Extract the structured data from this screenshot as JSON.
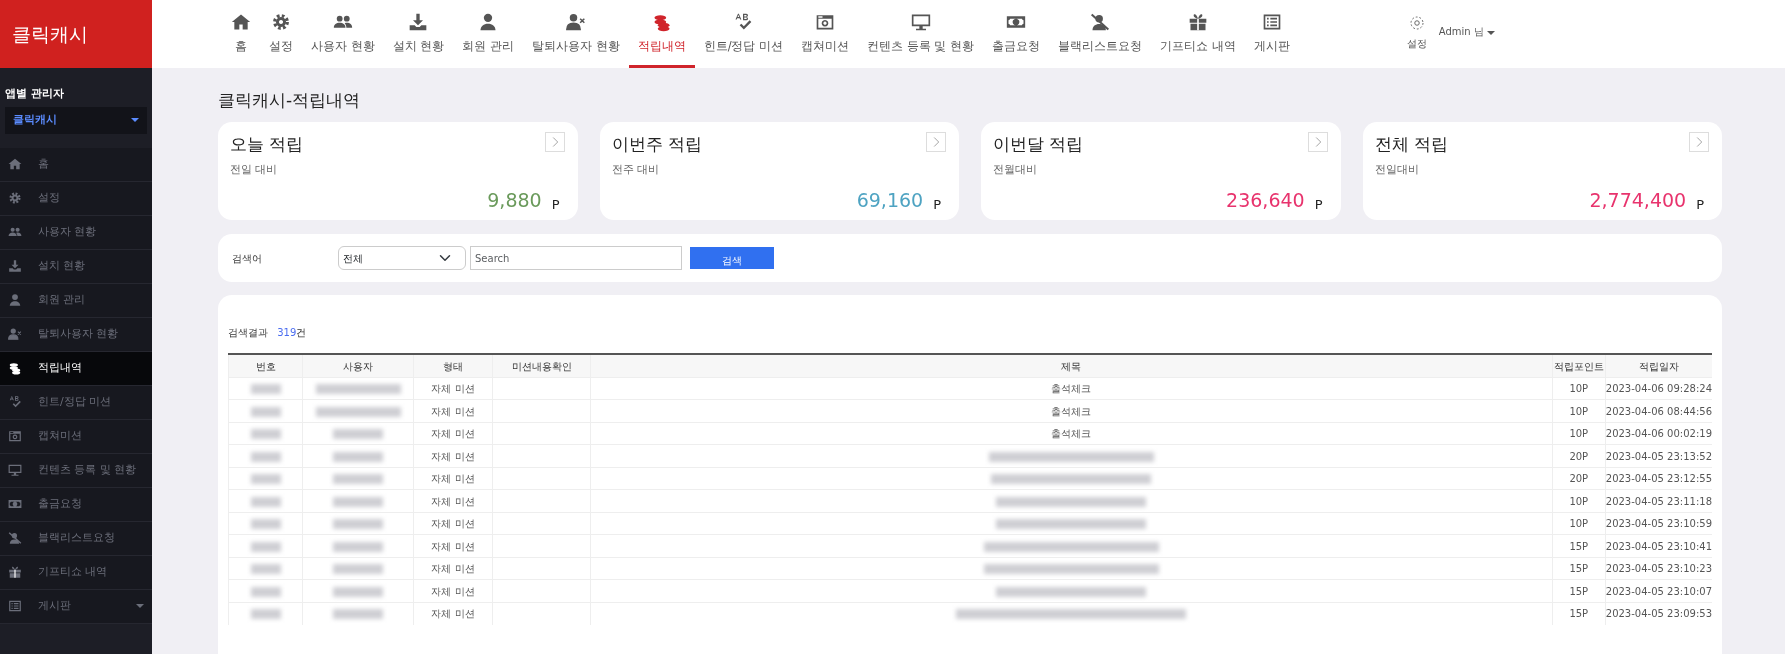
{
  "brand": "클릭캐시",
  "sidebar": {
    "section_title": "앱별 관리자",
    "app_select": "클릭캐시",
    "items": [
      {
        "label": "홈",
        "selected": false,
        "has_caret": false
      },
      {
        "label": "설정",
        "selected": false,
        "has_caret": false
      },
      {
        "label": "사용자 현황",
        "selected": false,
        "has_caret": false
      },
      {
        "label": "설치 현황",
        "selected": false,
        "has_caret": false
      },
      {
        "label": "회원 관리",
        "selected": false,
        "has_caret": false
      },
      {
        "label": "탈퇴사용자 현황",
        "selected": false,
        "has_caret": false
      },
      {
        "label": "적립내역",
        "selected": true,
        "has_caret": false
      },
      {
        "label": "힌트/정답 미션",
        "selected": false,
        "has_caret": false
      },
      {
        "label": "캡쳐미션",
        "selected": false,
        "has_caret": false
      },
      {
        "label": "컨텐츠 등록 및 현황",
        "selected": false,
        "has_caret": false
      },
      {
        "label": "출금요청",
        "selected": false,
        "has_caret": false
      },
      {
        "label": "블랙리스트요청",
        "selected": false,
        "has_caret": false
      },
      {
        "label": "기프티쇼 내역",
        "selected": false,
        "has_caret": false
      },
      {
        "label": "게시판",
        "selected": false,
        "has_caret": true
      }
    ]
  },
  "top_nav": {
    "items": [
      {
        "label": "홈",
        "selected": false
      },
      {
        "label": "설정",
        "selected": false
      },
      {
        "label": "사용자 현황",
        "selected": false
      },
      {
        "label": "설치 현황",
        "selected": false
      },
      {
        "label": "회원 관리",
        "selected": false
      },
      {
        "label": "탈퇴사용자 현황",
        "selected": false
      },
      {
        "label": "적립내역",
        "selected": true
      },
      {
        "label": "힌트/정답 미션",
        "selected": false
      },
      {
        "label": "캡쳐미션",
        "selected": false
      },
      {
        "label": "컨텐츠 등록 및 현황",
        "selected": false
      },
      {
        "label": "출금요청",
        "selected": false
      },
      {
        "label": "블랙리스트요청",
        "selected": false
      },
      {
        "label": "기프티쇼 내역",
        "selected": false
      },
      {
        "label": "게시판",
        "selected": false
      }
    ]
  },
  "user_menu": {
    "settings_label": "설정",
    "user": "Admin 님"
  },
  "page_title": "클릭캐시-적립내역",
  "stat_cards": [
    {
      "title": "오늘 적립",
      "subtitle": "전일 대비",
      "value": "9,880",
      "unit": "P",
      "color": "#6a9a5b"
    },
    {
      "title": "이번주 적립",
      "subtitle": "전주 대비",
      "value": "69,160",
      "unit": "P",
      "color": "#4ea3c2"
    },
    {
      "title": "이번달 적립",
      "subtitle": "전월대비",
      "value": "236,640",
      "unit": "P",
      "color": "#e8336d"
    },
    {
      "title": "전체 적립",
      "subtitle": "전일대비",
      "value": "2,774,400",
      "unit": "P",
      "color": "#e8336d"
    }
  ],
  "search": {
    "label": "검색어",
    "select_value": "전체",
    "placeholder": "Search",
    "button": "검색"
  },
  "results": {
    "label": "검색결과",
    "count": "319",
    "suffix": "건"
  },
  "table": {
    "columns": [
      "번호",
      "사용자",
      "형태",
      "미션내용확인",
      "제목",
      "적립포인트",
      "적립일자"
    ],
    "rows": [
      {
        "type": "자체 미션",
        "title": "출석체크",
        "points": "10P",
        "date": "2023-04-06 09:28:24"
      },
      {
        "type": "자체 미션",
        "title": "출석체크",
        "points": "10P",
        "date": "2023-04-06 08:44:56"
      },
      {
        "type": "자체 미션",
        "title": "출석체크",
        "points": "10P",
        "date": "2023-04-06 00:02:19"
      },
      {
        "type": "자체 미션",
        "points": "20P",
        "date": "2023-04-05 23:13:52"
      },
      {
        "type": "자체 미션",
        "points": "20P",
        "date": "2023-04-05 23:12:55"
      },
      {
        "type": "자체 미션",
        "points": "10P",
        "date": "2023-04-05 23:11:18"
      },
      {
        "type": "자체 미션",
        "points": "10P",
        "date": "2023-04-05 23:10:59"
      },
      {
        "type": "자체 미션",
        "points": "15P",
        "date": "2023-04-05 23:10:41"
      },
      {
        "type": "자체 미션",
        "points": "15P",
        "date": "2023-04-05 23:10:23"
      },
      {
        "type": "자체 미션",
        "points": "15P",
        "date": "2023-04-05 23:10:07"
      },
      {
        "type": "자체 미션",
        "points": "15P",
        "date": "2023-04-05 23:09:53"
      }
    ]
  }
}
